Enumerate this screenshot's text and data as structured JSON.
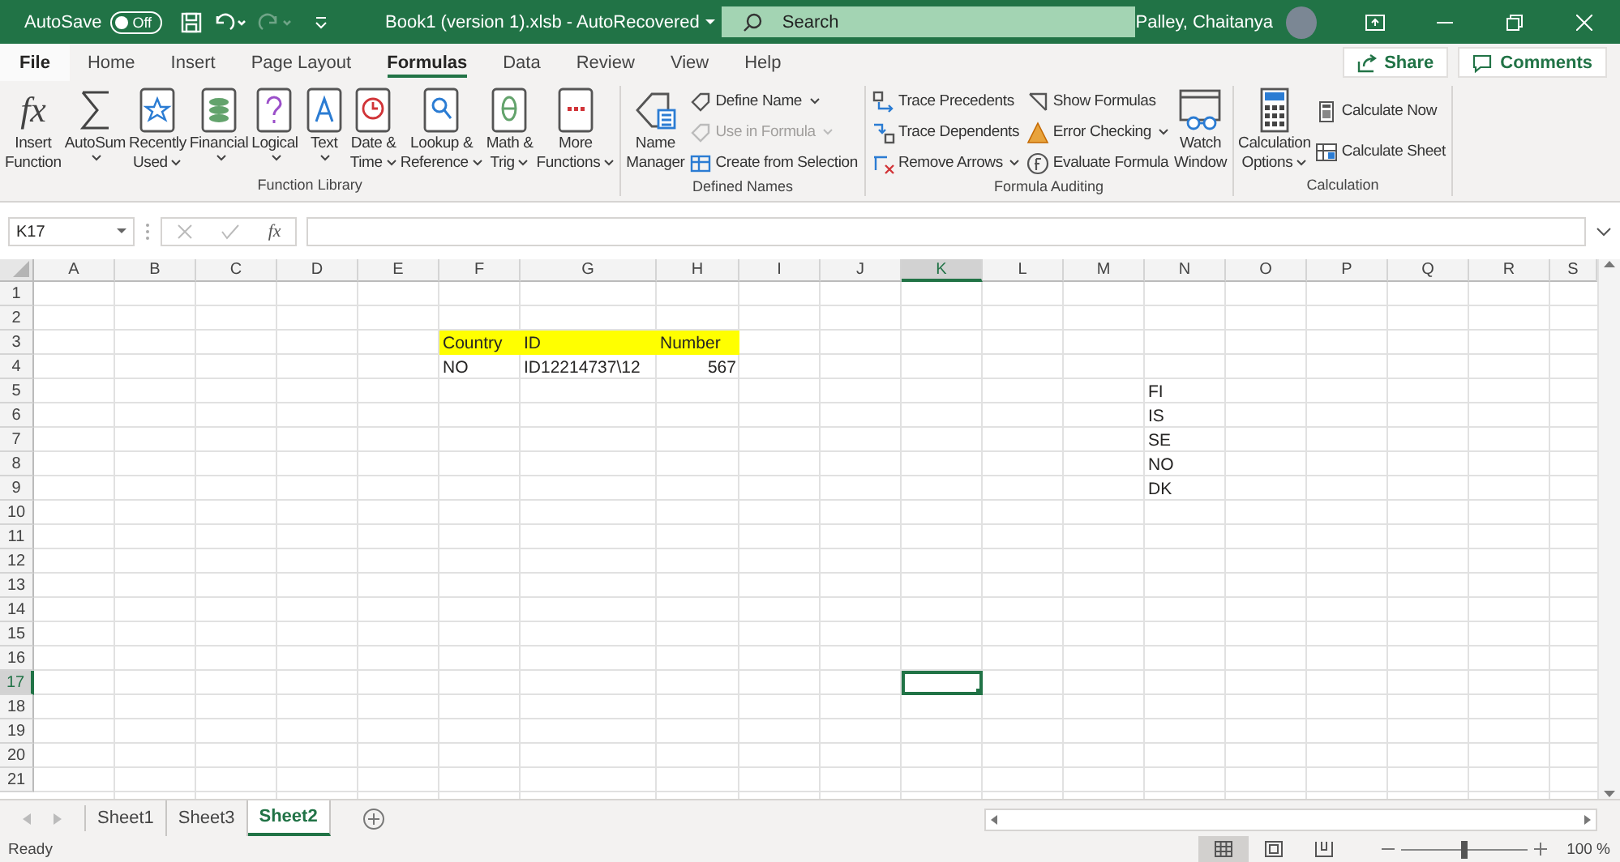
{
  "title_bar": {
    "autosave_label": "AutoSave",
    "autosave_on": false,
    "toggle_text": "Off",
    "redo_disabled": true,
    "title": "Book1 (version 1).xlsb  -  AutoRecovered",
    "search": {
      "placeholder": "Search"
    },
    "user_name": "Palley, Chaitanya"
  },
  "menu_tabs": [
    {
      "label": "File",
      "selected": false
    },
    {
      "label": "Home",
      "selected": false
    },
    {
      "label": "Insert",
      "selected": false
    },
    {
      "label": "Page Layout",
      "selected": false
    },
    {
      "label": "Formulas",
      "selected": true
    },
    {
      "label": "Data",
      "selected": false
    },
    {
      "label": "Review",
      "selected": false
    },
    {
      "label": "View",
      "selected": false
    },
    {
      "label": "Help",
      "selected": false
    }
  ],
  "share_button": "Share",
  "comments_button": "Comments",
  "ribbon": {
    "groups": [
      {
        "label": "Function Library",
        "large": [
          {
            "lines": [
              "Insert",
              "Function"
            ],
            "dropdown": false,
            "symbol": "fx"
          },
          {
            "lines": [
              "AutoSum"
            ],
            "dropdown": true
          },
          {
            "lines": [
              "Recently",
              "Used"
            ],
            "dropdown": true
          },
          {
            "lines": [
              "Financial"
            ],
            "dropdown": true
          },
          {
            "lines": [
              "Logical"
            ],
            "dropdown": true
          },
          {
            "lines": [
              "Text"
            ],
            "dropdown": true
          },
          {
            "lines": [
              "Date &",
              "Time"
            ],
            "dropdown": true
          },
          {
            "lines": [
              "Lookup &",
              "Reference"
            ],
            "dropdown": true
          },
          {
            "lines": [
              "Math &",
              "Trig"
            ],
            "dropdown": true
          },
          {
            "lines": [
              "More",
              "Functions"
            ],
            "dropdown": true
          }
        ]
      },
      {
        "label": "Defined Names",
        "large": [
          {
            "lines": [
              "Name",
              "Manager"
            ],
            "dropdown": false
          }
        ],
        "small": [
          {
            "label": "Define Name",
            "dropdown": true,
            "disabled": false
          },
          {
            "label": "Use in Formula",
            "dropdown": true,
            "disabled": true
          },
          {
            "label": "Create from Selection",
            "dropdown": false,
            "disabled": false
          }
        ]
      },
      {
        "label": "Formula Auditing",
        "small": [
          {
            "label": "Trace Precedents",
            "dropdown": false,
            "disabled": false
          },
          {
            "label": "Trace Dependents",
            "dropdown": false,
            "disabled": false
          },
          {
            "label": "Remove Arrows",
            "dropdown": true,
            "disabled": false
          },
          {
            "label": "Show Formulas",
            "dropdown": false,
            "disabled": false
          },
          {
            "label": "Error Checking",
            "dropdown": true,
            "disabled": false
          },
          {
            "label": "Evaluate Formula",
            "dropdown": false,
            "disabled": false
          }
        ],
        "trailing_large": [
          {
            "lines": [
              "Watch",
              "Window"
            ],
            "dropdown": false
          }
        ]
      },
      {
        "label": "Calculation",
        "large": [
          {
            "lines": [
              "Calculation",
              "Options"
            ],
            "dropdown": true
          }
        ],
        "small": [
          {
            "label": "Calculate Now",
            "dropdown": false,
            "disabled": false
          },
          {
            "label": "Calculate Sheet",
            "dropdown": false,
            "disabled": false
          }
        ]
      }
    ]
  },
  "formula_bar": {
    "name_box": "K17",
    "function_symbol": "fx"
  },
  "sheet": {
    "columns": [
      {
        "label": "A",
        "selected": false
      },
      {
        "label": "B",
        "selected": false
      },
      {
        "label": "C",
        "selected": false
      },
      {
        "label": "D",
        "selected": false
      },
      {
        "label": "E",
        "selected": false
      },
      {
        "label": "F",
        "selected": false
      },
      {
        "label": "G",
        "selected": false
      },
      {
        "label": "H",
        "selected": false
      },
      {
        "label": "I",
        "selected": false
      },
      {
        "label": "J",
        "selected": false
      },
      {
        "label": "K",
        "selected": true
      },
      {
        "label": "L",
        "selected": false
      },
      {
        "label": "M",
        "selected": false
      },
      {
        "label": "N",
        "selected": false
      },
      {
        "label": "O",
        "selected": false
      },
      {
        "label": "P",
        "selected": false
      },
      {
        "label": "Q",
        "selected": false
      },
      {
        "label": "R",
        "selected": false
      },
      {
        "label": "S",
        "selected": false
      }
    ],
    "rows": [
      {
        "label": "1",
        "selected": false
      },
      {
        "label": "2",
        "selected": false
      },
      {
        "label": "3",
        "selected": false
      },
      {
        "label": "4",
        "selected": false
      },
      {
        "label": "5",
        "selected": false
      },
      {
        "label": "6",
        "selected": false
      },
      {
        "label": "7",
        "selected": false
      },
      {
        "label": "8",
        "selected": false
      },
      {
        "label": "9",
        "selected": false
      },
      {
        "label": "10",
        "selected": false
      },
      {
        "label": "11",
        "selected": false
      },
      {
        "label": "12",
        "selected": false
      },
      {
        "label": "13",
        "selected": false
      },
      {
        "label": "14",
        "selected": false
      },
      {
        "label": "15",
        "selected": false
      },
      {
        "label": "16",
        "selected": false
      },
      {
        "label": "17",
        "selected": true
      },
      {
        "label": "18",
        "selected": false
      },
      {
        "label": "19",
        "selected": false
      },
      {
        "label": "20",
        "selected": false
      },
      {
        "label": "21",
        "selected": false
      }
    ],
    "table": {
      "header": [
        "Country",
        "ID",
        "Number"
      ],
      "rows": [
        [
          "NO",
          "ID12214737\\12",
          "567"
        ]
      ]
    },
    "list": [
      "FI",
      "IS",
      "SE",
      "NO",
      "DK"
    ]
  },
  "sheet_tabs": [
    {
      "label": "Sheet1",
      "selected": false
    },
    {
      "label": "Sheet3",
      "selected": false
    },
    {
      "label": "Sheet2",
      "selected": true
    }
  ],
  "status_bar": {
    "status": "Ready",
    "views": [
      {
        "selected": true
      },
      {
        "selected": false
      },
      {
        "selected": false
      }
    ],
    "zoom": {
      "level": 0.5,
      "reading": "100 %"
    }
  }
}
